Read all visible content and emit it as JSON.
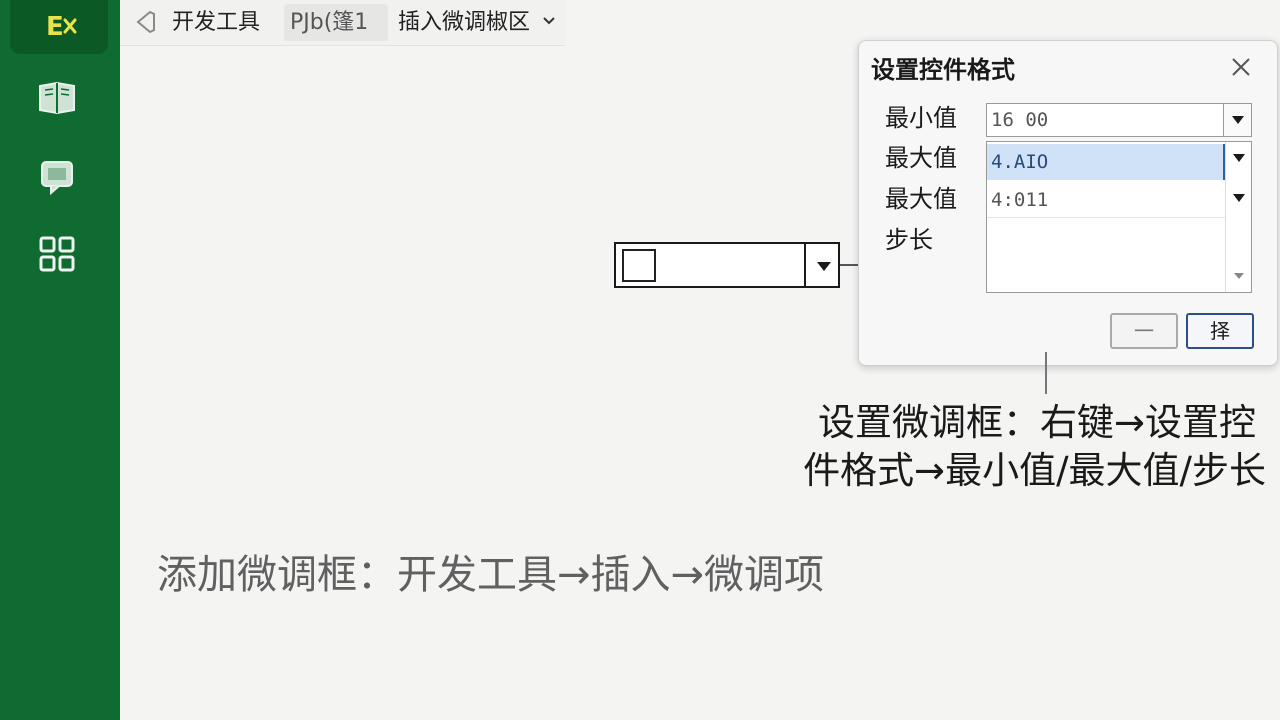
{
  "app": {
    "logo_text": "E",
    "accent_color": "#0f6b2f"
  },
  "sidebar": {
    "items": [
      {
        "icon": "book-icon"
      },
      {
        "icon": "comment-icon"
      },
      {
        "icon": "grid-icon"
      }
    ]
  },
  "toolbar": {
    "tabs": [
      {
        "label": "开发工具"
      },
      {
        "label": "PJb(篷1"
      },
      {
        "label": "插入微调椒区"
      }
    ]
  },
  "dialog": {
    "title": "设置控件格式",
    "fields": [
      {
        "label": "最小值",
        "value": "16 00"
      },
      {
        "label": "最大值",
        "value": "4.AIO"
      },
      {
        "label": "最大值",
        "value": "4:011"
      },
      {
        "label": "步长"
      }
    ],
    "buttons": {
      "cancel": "一",
      "ok": "择"
    }
  },
  "captions": {
    "right_line1": "设置微调框：右键→设置控",
    "right_line2": "件格式→最小值/最大值/步长",
    "main": "添加微调框：开发工具→插入→微调项"
  }
}
